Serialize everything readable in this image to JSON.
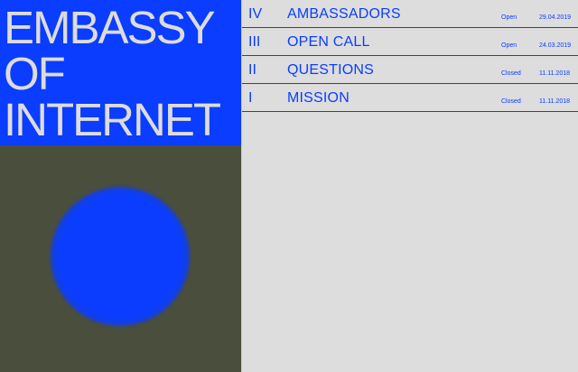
{
  "title": {
    "line1": "EMBASSY",
    "line2": "OF",
    "line3": "INTERNET"
  },
  "colors": {
    "accent_blue": "#0a3dff",
    "panel_background": "#dddddd",
    "image_background": "#4a4e3c",
    "title_text": "#dcdcdc"
  },
  "list": {
    "rows": [
      {
        "numeral": "IV",
        "name": "AMBASSADORS",
        "status": "Open",
        "date": "29.04.2019"
      },
      {
        "numeral": "III",
        "name": "OPEN CALL",
        "status": "Open",
        "date": "24.03.2019"
      },
      {
        "numeral": "II",
        "name": "QUESTIONS",
        "status": "Closed",
        "date": "11.11.2018"
      },
      {
        "numeral": "I",
        "name": "MISSION",
        "status": "Closed",
        "date": "11.11.2018"
      }
    ]
  }
}
